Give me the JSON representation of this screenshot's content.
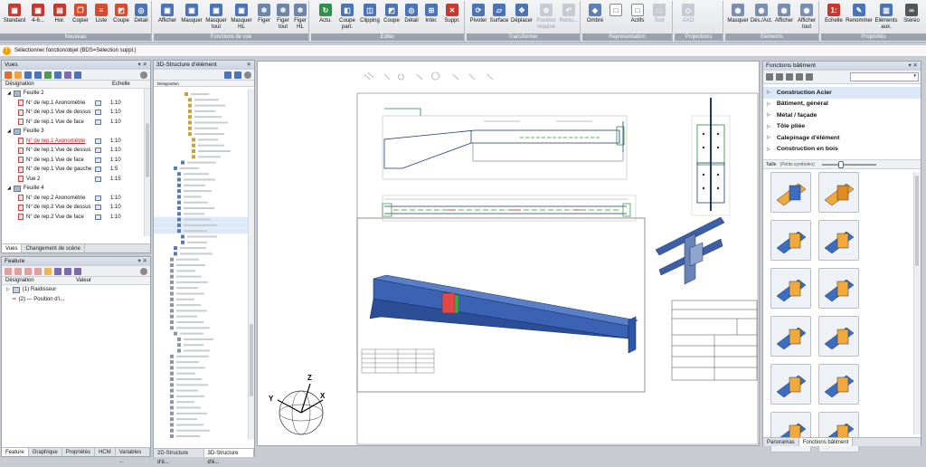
{
  "ribbon": {
    "groups": [
      {
        "title": "Nouveau",
        "buttons": [
          "Standard",
          "4-6...",
          "Hor.",
          "Copier",
          "Liste",
          "Coupe",
          "Détail"
        ]
      },
      {
        "title": "Fonctions de vue",
        "buttons": [
          "Afficher",
          "Masquer",
          "Masquer tout",
          "Masquer HL",
          "Figer",
          "Figer tout",
          "Figer HL"
        ]
      },
      {
        "title": "Editer",
        "buttons": [
          "Actu.",
          "Coupe part.",
          "Clipping",
          "Coupe",
          "Détail",
          "Inter.",
          "Suppr."
        ]
      },
      {
        "title": "Transformer",
        "buttons": [
          "Pivoter",
          "Surface",
          "Déplacer",
          "Position requise",
          "Retou..."
        ]
      },
      {
        "title": "Représentation",
        "buttons": [
          "Ombré",
          "Actifs",
          "Tout"
        ]
      },
      {
        "title": "Projections",
        "buttons": [
          "AXO"
        ]
      },
      {
        "title": "Eléments",
        "buttons": [
          "Masquer",
          "Dés./Act.",
          "Afficher",
          "Afficher tout"
        ]
      },
      {
        "title": "Propriétés",
        "buttons": [
          "Echelle",
          "Renommer",
          "Eléments aux.",
          "Stéréo"
        ]
      }
    ]
  },
  "status": {
    "text": "Sélectionner fonction/objet (BDS=Sélection suppl.)"
  },
  "vues_panel": {
    "title": "Vues",
    "col_designation": "Désignation",
    "col_scale": "Echelle",
    "rows": [
      {
        "level": 0,
        "label": "Feuille 2",
        "scale": ""
      },
      {
        "level": 1,
        "label": "N° de rep.1 Axonométrie",
        "scale": "1:10"
      },
      {
        "level": 1,
        "label": "N° de rep.1 Vue de dessus",
        "scale": "1:10"
      },
      {
        "level": 1,
        "label": "N° de rep.1 Vue de face",
        "scale": "1:10"
      },
      {
        "level": 0,
        "label": "Feuille 3",
        "scale": ""
      },
      {
        "level": 1,
        "label": "N° de rep.1 Axonométrie",
        "scale": "1:10",
        "highlight": true
      },
      {
        "level": 1,
        "label": "N° de rep.1 Vue de dessus",
        "scale": "1:10"
      },
      {
        "level": 1,
        "label": "N° de rep.1 Vue de face",
        "scale": "1:10"
      },
      {
        "level": 1,
        "label": "N° de rep.1 Vue de gauche",
        "scale": "1:5"
      },
      {
        "level": 1,
        "label": "Vue 2",
        "scale": "1:15"
      },
      {
        "level": 0,
        "label": "Feuille 4",
        "scale": ""
      },
      {
        "level": 1,
        "label": "N° de rep.2 Axonométrie",
        "scale": "1:10"
      },
      {
        "level": 1,
        "label": "N° de rep.2 Vue de dessus",
        "scale": "1:10"
      },
      {
        "level": 1,
        "label": "N° de rep.2 Vue de face",
        "scale": "1:10"
      }
    ],
    "tabs": [
      "Vues",
      "Changement de scène"
    ]
  },
  "feature_panel": {
    "title": "Feature",
    "col_designation": "Désignation",
    "col_value": "Valeur",
    "rows": [
      "(1) Raidisseur",
      "(2) --- Position  d'i..."
    ],
    "tabs": [
      "Feature",
      "Graphique",
      "Propriétés",
      "HCM",
      "Variables ..."
    ]
  },
  "tree_panel": {
    "title": "3D-Structure d'élément",
    "col_designation": "Désignation",
    "tabs": [
      "2D-Structure d'é...",
      "3D-Structure d'é..."
    ]
  },
  "right_panel": {
    "title": "Fonctions bâtiment",
    "libraries": [
      "Construction Acier",
      "Bâtiment, général",
      "Métal / façade",
      "Tôle pliée",
      "Calepinage d'élément",
      "Construction en bois"
    ],
    "toolbar_label": "Taille",
    "toolbar_value": "(Petits symboles)",
    "tabs": [
      "Panoramas",
      "Fonctions bâtiment"
    ]
  },
  "axis": {
    "x": "X",
    "y": "Y",
    "z": "Z"
  }
}
